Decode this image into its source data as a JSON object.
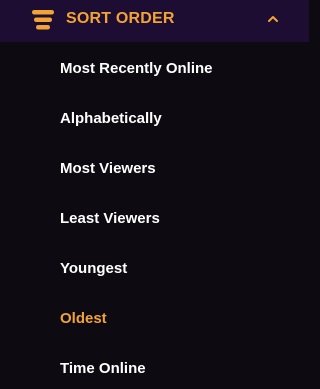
{
  "header": {
    "title": "SORT ORDER",
    "icon": "sort-bars-icon",
    "toggle_icon": "chevron-up-icon",
    "accent_color": "#f2a335",
    "background_color": "#1e0d33"
  },
  "options": [
    {
      "label": "Most Recently Online",
      "selected": false
    },
    {
      "label": "Alphabetically",
      "selected": false
    },
    {
      "label": "Most Viewers",
      "selected": false
    },
    {
      "label": "Least Viewers",
      "selected": false
    },
    {
      "label": "Youngest",
      "selected": false
    },
    {
      "label": "Oldest",
      "selected": true
    },
    {
      "label": "Time Online",
      "selected": false
    }
  ],
  "colors": {
    "menu_background": "#0e0a11",
    "text": "#ffffff",
    "selected_text": "#f2a335"
  }
}
